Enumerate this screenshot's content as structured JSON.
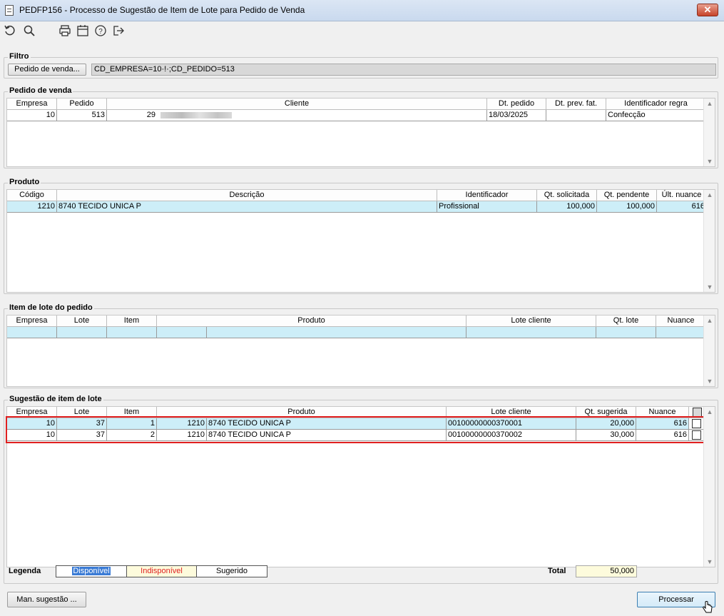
{
  "window": {
    "title": "PEDFP156 - Processo de Sugestão de Item de Lote para Pedido de Venda",
    "close_label": "✕"
  },
  "toolbar": {
    "icons": [
      "refresh-icon",
      "search-icon",
      "print-icon",
      "calendar-icon",
      "help-icon",
      "exit-icon"
    ]
  },
  "filtro": {
    "title": "Filtro",
    "button_label": "Pedido de venda...",
    "value": "CD_EMPRESA=10·!·;CD_PEDIDO=513"
  },
  "pedido": {
    "title": "Pedido de venda",
    "headers": [
      "Empresa",
      "Pedido",
      "Cliente",
      "Dt. pedido",
      "Dt. prev. fat.",
      "Identificador regra"
    ],
    "row": {
      "empresa": "10",
      "pedido": "513",
      "cliente_code": "29",
      "dt_pedido": "18/03/2025",
      "dt_prev_fat": "",
      "identificador": "Confecção"
    }
  },
  "produto": {
    "title": "Produto",
    "headers": [
      "Código",
      "Descrição",
      "Identificador",
      "Qt. solicitada",
      "Qt. pendente",
      "Últ. nuance"
    ],
    "row": {
      "codigo": "1210",
      "descricao": "8740 TECIDO UNICA P",
      "identificador": "Profissional",
      "qt_solicitada": "100,000",
      "qt_pendente": "100,000",
      "ult_nuance": "616"
    }
  },
  "item_lote": {
    "title": "Item de lote do pedido",
    "headers": [
      "Empresa",
      "Lote",
      "Item",
      "Produto",
      "Lote cliente",
      "Qt. lote",
      "Nuance"
    ]
  },
  "sugestao": {
    "title": "Sugestão de item de lote",
    "headers": [
      "Empresa",
      "Lote",
      "Item",
      "Produto",
      "Lote cliente",
      "Qt. sugerida",
      "Nuance"
    ],
    "rows": [
      {
        "empresa": "10",
        "lote": "37",
        "item": "1",
        "produto_cod": "1210",
        "produto_desc": "8740 TECIDO UNICA P",
        "lote_cliente": "00100000000370001",
        "qt_sugerida": "20,000",
        "nuance": "616"
      },
      {
        "empresa": "10",
        "lote": "37",
        "item": "2",
        "produto_cod": "1210",
        "produto_desc": "8740 TECIDO UNICA P",
        "lote_cliente": "00100000000370002",
        "qt_sugerida": "30,000",
        "nuance": "616"
      }
    ]
  },
  "legenda": {
    "label": "Legenda",
    "items": [
      {
        "text": "Disponível",
        "color": "#ffffff",
        "bg": "#3a7bd5"
      },
      {
        "text": "Indisponível",
        "color": "#e02020",
        "bg": "#fdfbdc"
      },
      {
        "text": "Sugerido",
        "color": "#000000",
        "bg": "#ffffff"
      }
    ]
  },
  "total": {
    "label": "Total",
    "value": "50,000"
  },
  "buttons": {
    "man_sugestao": "Man. sugestão ...",
    "processar": "Processar"
  },
  "colors": {
    "selected_row": "#cdeef8",
    "highlight_border": "#e02020"
  }
}
